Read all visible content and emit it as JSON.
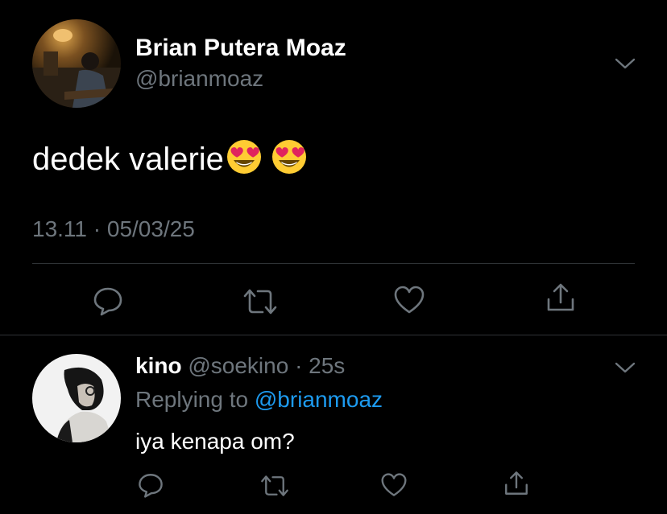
{
  "main_tweet": {
    "author_name": "Brian Putera Moaz",
    "author_handle": "@brianmoaz",
    "text": "dedek valerie",
    "emoji": [
      "smiling-face-with-heart-eyes",
      "smiling-face-with-heart-eyes"
    ],
    "timestamp": "13.11 · 05/03/25"
  },
  "reply": {
    "author_name": "kino",
    "author_handle": "@soekino",
    "time": "· 25s",
    "replying_prefix": "Replying to",
    "replying_handle": "@brianmoaz",
    "text": "iya kenapa om?"
  },
  "icons": {
    "reply": "speech-bubble-icon",
    "retweet": "retweet-icon",
    "like": "heart-icon",
    "share": "share-icon",
    "more": "chevron-down-icon"
  },
  "colors": {
    "background": "#000000",
    "text": "#ffffff",
    "muted": "#6e767d",
    "link": "#1d9bf0",
    "separator": "#2f3336",
    "emoji_face": "#ffcc33",
    "emoji_heart": "#e0245e"
  }
}
